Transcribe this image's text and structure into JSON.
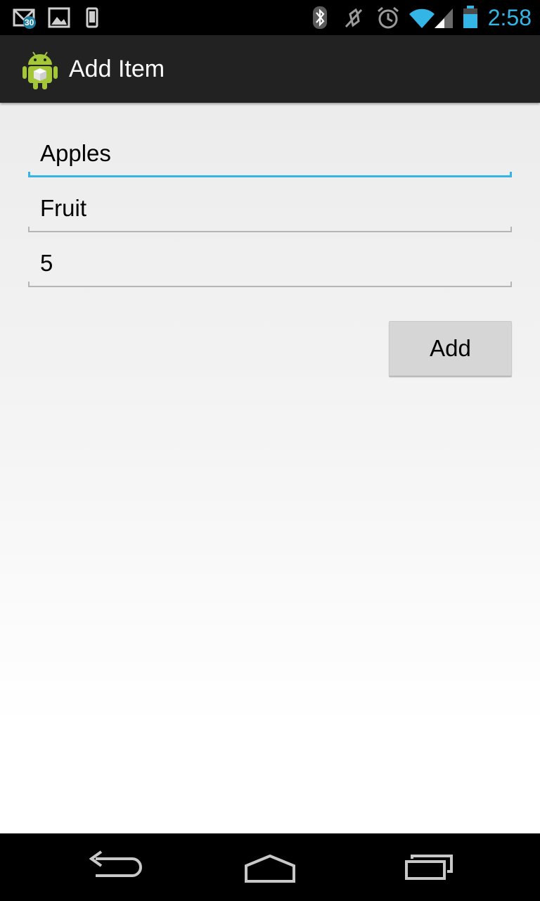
{
  "status_bar": {
    "time": "2:58",
    "notification_count": "30",
    "icons": [
      "gmail-icon",
      "gallery-icon",
      "phone-icon",
      "bluetooth-icon",
      "mute-icon",
      "alarm-icon",
      "wifi-icon",
      "signal-icon",
      "battery-icon"
    ],
    "accent_color": "#33b5e5"
  },
  "action_bar": {
    "title": "Add Item",
    "icon": "android-icon"
  },
  "form": {
    "name_value": "Apples",
    "category_value": "Fruit",
    "quantity_value": "5",
    "add_label": "Add"
  },
  "nav_bar": {
    "icons": [
      "back-icon",
      "home-icon",
      "recents-icon"
    ]
  }
}
